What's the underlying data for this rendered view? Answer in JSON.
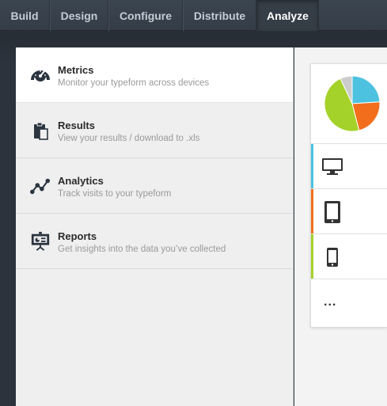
{
  "nav": {
    "tabs": [
      {
        "label": "Build"
      },
      {
        "label": "Design"
      },
      {
        "label": "Configure"
      },
      {
        "label": "Distribute"
      },
      {
        "label": "Analyze",
        "active": true
      }
    ]
  },
  "menu": {
    "items": [
      {
        "title": "Metrics",
        "desc": "Monitor your typeform across devices",
        "icon": "speedometer-icon",
        "selected": true
      },
      {
        "title": "Results",
        "desc": "View your results / download to .xls",
        "icon": "clipboard-icon"
      },
      {
        "title": "Analytics",
        "desc": "Track visits to your typeform",
        "icon": "line-chart-icon"
      },
      {
        "title": "Reports",
        "desc": "Get insights into the data you’ve collected",
        "icon": "presentation-board-icon"
      }
    ]
  },
  "metrics": {
    "pie": [
      {
        "device": "desktop",
        "color": "#4cc2e0",
        "fraction": 0.24
      },
      {
        "device": "tablet",
        "color": "#f26e1c",
        "fraction": 0.22
      },
      {
        "device": "phone",
        "color": "#a5d22a",
        "fraction": 0.47
      },
      {
        "device": "other",
        "color": "#cccccc",
        "fraction": 0.07
      }
    ],
    "devices": [
      {
        "name": "desktop",
        "icon": "desktop-monitor-icon",
        "color": "#4cc2e0"
      },
      {
        "name": "tablet",
        "icon": "tablet-icon",
        "color": "#f26e1c"
      },
      {
        "name": "phone",
        "icon": "smartphone-icon",
        "color": "#a5d22a"
      },
      {
        "name": "more",
        "icon": "more-dots-icon",
        "label": "..."
      }
    ]
  }
}
